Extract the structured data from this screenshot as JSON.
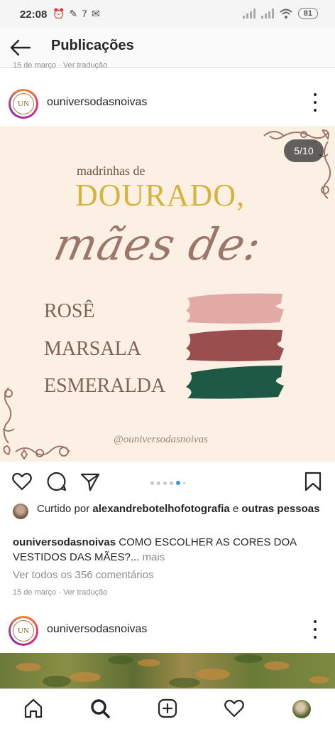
{
  "status_bar": {
    "time": "22:08",
    "battery": "81"
  },
  "header": {
    "title": "Publicações"
  },
  "previous_post": {
    "meta": "15 de março · Ver tradução"
  },
  "post": {
    "username": "ouniversodasnoivas",
    "avatar_text": "UN",
    "image_counter": "5/10",
    "image_text": {
      "line1": "madrinhas de",
      "line2": "DOURADO,",
      "line3": "mães de:",
      "colors": [
        {
          "label": "ROSÊ",
          "swatch": "#e2aaa5"
        },
        {
          "label": "MARSALA",
          "swatch": "#9a4f4e"
        },
        {
          "label": "ESMERALDA",
          "swatch": "#1d5944"
        }
      ],
      "handle": "@ouniversodasnoivas"
    },
    "liked_by_prefix": "Curtido por",
    "liked_by_user": "alexandrebotelhofotografia",
    "liked_by_and": "e",
    "liked_by_others": "outras pessoas",
    "caption_user": "ouniversodasnoivas",
    "caption_text": "COMO ESCOLHER AS CORES DOA VESTIDOS DAS MÃES?...",
    "caption_more": "mais",
    "comments_link": "Ver todos os 356 comentários",
    "date": "15 de março",
    "translate": "Ver tradução"
  },
  "next_post": {
    "username": "ouniversodasnoivas",
    "avatar_text": "UN"
  },
  "colors": {
    "accent_blue": "#3897f0",
    "gold": "#d5b43d",
    "mauve": "#9b766a"
  }
}
